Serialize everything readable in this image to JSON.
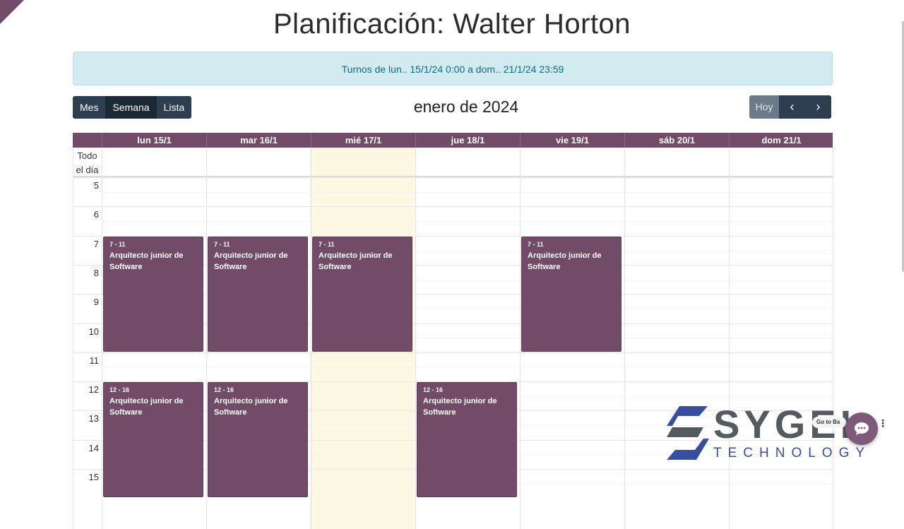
{
  "page": {
    "title": "Planificación: Walter Horton",
    "alert": "Turnos de lun.. 15/1/24 0:00 a dom.. 21/1/24 23:59"
  },
  "toolbar": {
    "views": [
      {
        "label": "Mes",
        "active": false
      },
      {
        "label": "Semana",
        "active": true
      },
      {
        "label": "Lista",
        "active": false
      }
    ],
    "month_label": "enero de 2024",
    "today_label": "Hoy",
    "prev_icon": "chevron-left-icon",
    "next_icon": "chevron-right-icon"
  },
  "calendar": {
    "days": [
      "lun 15/1",
      "mar 16/1",
      "mié 17/1",
      "jue 18/1",
      "vie 19/1",
      "sáb 20/1",
      "dom 21/1"
    ],
    "today_index": 2,
    "allday_label_line1": "Todo",
    "allday_label_line2": "el día",
    "hours": [
      "5",
      "6",
      "7",
      "8",
      "9",
      "10",
      "11",
      "12",
      "13",
      "14",
      "15"
    ],
    "events": [
      {
        "day": 0,
        "start": 7,
        "end": 11,
        "time": "7 - 11",
        "name": "Arquitecto junior de Software"
      },
      {
        "day": 1,
        "start": 7,
        "end": 11,
        "time": "7 - 11",
        "name": "Arquitecto junior de Software"
      },
      {
        "day": 2,
        "start": 7,
        "end": 11,
        "time": "7 - 11",
        "name": "Arquitecto junior de Software"
      },
      {
        "day": 4,
        "start": 7,
        "end": 11,
        "time": "7 - 11",
        "name": "Arquitecto junior de Software"
      },
      {
        "day": 0,
        "start": 12,
        "end": 16,
        "time": "12 - 16",
        "name": "Arquitecto junior de Software"
      },
      {
        "day": 1,
        "start": 12,
        "end": 16,
        "time": "12 - 16",
        "name": "Arquitecto junior de Software"
      },
      {
        "day": 3,
        "start": 12,
        "end": 16,
        "time": "12 - 16",
        "name": "Arquitecto junior de Software"
      }
    ],
    "colors": {
      "header": "#714b67",
      "event": "#714b67",
      "today": "#fcf8e3"
    }
  },
  "branding": {
    "logo_word": "SYGEL",
    "logo_sub": "TECHNOLOGY"
  },
  "chat": {
    "tooltip": "Go to Ba",
    "icon": "chat-bubble-icon",
    "menu_icon": "kebab-menu-icon"
  }
}
